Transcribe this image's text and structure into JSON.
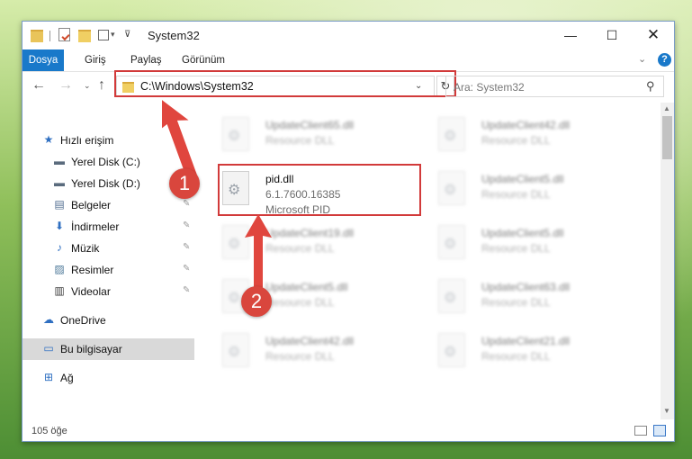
{
  "window": {
    "title": "System32",
    "controls": {
      "minimize": "—",
      "maximize": "☐",
      "close": "✕"
    }
  },
  "ribbon": {
    "tabs": [
      "Dosya",
      "Giriş",
      "Paylaş",
      "Görünüm"
    ],
    "expand_glyph": "⌄",
    "help_glyph": "?"
  },
  "navigation": {
    "back_glyph": "←",
    "forward_glyph": "→",
    "recent_glyph": "⌄",
    "up_glyph": "↑",
    "address": "C:\\Windows\\System32",
    "address_dropdown_glyph": "⌄",
    "refresh_glyph": "↻",
    "search_placeholder": "Ara: System32",
    "search_glyph": "⚲"
  },
  "sidebar": {
    "items": [
      {
        "label": "Hızlı erişim",
        "icon": "star-icon",
        "glyph": "★",
        "color": "#2f6fc1",
        "pinned": false
      },
      {
        "label": "Yerel Disk (C:)",
        "icon": "drive-icon",
        "glyph": "▬",
        "color": "#5a6b7d",
        "pinned": true
      },
      {
        "label": "Yerel Disk (D:)",
        "icon": "drive-icon",
        "glyph": "▬",
        "color": "#5a6b7d",
        "pinned": true
      },
      {
        "label": "Belgeler",
        "icon": "documents-icon",
        "glyph": "▤",
        "color": "#4f6c8f",
        "pinned": true
      },
      {
        "label": "İndirmeler",
        "icon": "download-icon",
        "glyph": "⬇",
        "color": "#2f6fc1",
        "pinned": true
      },
      {
        "label": "Müzik",
        "icon": "music-icon",
        "glyph": "♪",
        "color": "#2f6fc1",
        "pinned": true
      },
      {
        "label": "Resimler",
        "icon": "pictures-icon",
        "glyph": "▨",
        "color": "#4f7a9a",
        "pinned": true
      },
      {
        "label": "Videolar",
        "icon": "video-icon",
        "glyph": "▥",
        "color": "#3c3c3c",
        "pinned": true
      },
      {
        "label": "OneDrive",
        "icon": "cloud-icon",
        "glyph": "☁",
        "color": "#2f6fc1",
        "pinned": false
      },
      {
        "label": "Bu bilgisayar",
        "icon": "computer-icon",
        "glyph": "▭",
        "color": "#2f6fc1",
        "pinned": false,
        "selected": true
      },
      {
        "label": "Ağ",
        "icon": "network-icon",
        "glyph": "⊞",
        "color": "#2f6fc1",
        "pinned": false
      }
    ],
    "pin_glyph": "✎"
  },
  "files": [
    {
      "name": "UpdateClient65.dll",
      "type": "Resource DLL",
      "blurred": true
    },
    {
      "name": "UpdateClient42.dll",
      "type": "Resource DLL",
      "blurred": true
    },
    {
      "name": "pid.dll",
      "version": "6.1.7600.16385",
      "company": "Microsoft PID",
      "blurred": false,
      "highlighted": true
    },
    {
      "name": "UpdateClient5.dll",
      "type": "Resource DLL",
      "blurred": true
    },
    {
      "name": "UpdateClient19.dll",
      "type": "Resource DLL",
      "blurred": true
    },
    {
      "name": "UpdateClient5.dll",
      "type": "Resource DLL",
      "blurred": true
    },
    {
      "name": "UpdateClient5.dll",
      "type": "Resource DLL",
      "blurred": true
    },
    {
      "name": "UpdateClient63.dll",
      "type": "Resource DLL",
      "blurred": true
    },
    {
      "name": "UpdateClient42.dll",
      "type": "Resource DLL",
      "blurred": true
    },
    {
      "name": "UpdateClient21.dll",
      "type": "Resource DLL",
      "blurred": true
    }
  ],
  "status": {
    "item_count": "105 öğe"
  },
  "annotations": {
    "badge1": "1",
    "badge2": "2",
    "highlight_color": "#d23a3a",
    "badge_color": "#d9463d"
  }
}
